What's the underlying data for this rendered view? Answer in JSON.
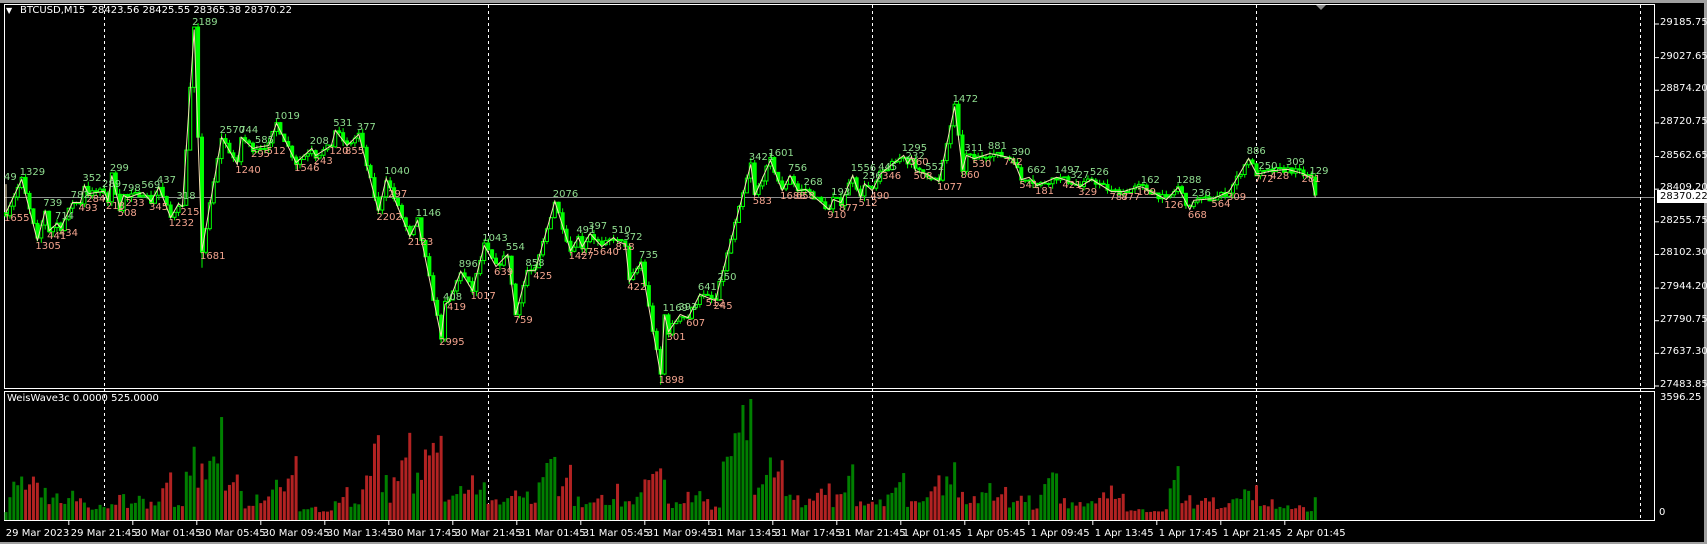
{
  "header": {
    "symbol_timeframe": "BTCUSD,M15",
    "ohlc": "28423.56 28425.55 28365.38 28370.22"
  },
  "indicator": {
    "label": "WeisWave3c 0.0000 525.0000",
    "max": "3596.25",
    "min": "0"
  },
  "current_price": "28370.22",
  "price_axis": [
    "29185.75",
    "29027.65",
    "28874.20",
    "28720.75",
    "28562.65",
    "28409.20",
    "28255.75",
    "28102.30",
    "27944.20",
    "27790.75",
    "27637.30",
    "27483.85"
  ],
  "time_axis": [
    "29 Mar 2023",
    "29 Mar 21:45",
    "30 Mar 01:45",
    "30 Mar 05:45",
    "30 Mar 09:45",
    "30 Mar 13:45",
    "30 Mar 17:45",
    "30 Mar 21:45",
    "31 Mar 01:45",
    "31 Mar 05:45",
    "31 Mar 09:45",
    "31 Mar 13:45",
    "31 Mar 17:45",
    "31 Mar 21:45",
    "1 Apr 01:45",
    "1 Apr 05:45",
    "1 Apr 09:45",
    "1 Apr 13:45",
    "1 Apr 17:45",
    "1 Apr 21:45",
    "2 Apr 01:45"
  ],
  "colors": {
    "candle": "#00ff00",
    "zigzag": "#f5deb3",
    "up_volume": "#008000",
    "down_volume": "#b22222",
    "high_label": "#8fdc8f",
    "low_label": "#f4a48e",
    "price_line": "#8c8c8c"
  },
  "wave_labels": [
    [
      0,
      28463,
      "49",
      "h"
    ],
    [
      0,
      28269,
      "1655",
      "l"
    ],
    [
      4,
      28485,
      "1329",
      "h"
    ],
    [
      8,
      28137,
      "1305",
      "l"
    ],
    [
      10,
      28339,
      "739",
      "h"
    ],
    [
      11,
      28184,
      "441",
      "l"
    ],
    [
      13,
      28278,
      "714",
      "h"
    ],
    [
      14,
      28198,
      "434",
      "l"
    ],
    [
      17,
      28377,
      "782",
      "h"
    ],
    [
      19,
      28316,
      "493",
      "l"
    ],
    [
      20,
      28457,
      "352",
      "h"
    ],
    [
      21,
      28358,
      "284",
      "l"
    ],
    [
      25,
      28429,
      "289",
      "h"
    ],
    [
      26,
      28325,
      "218",
      "l"
    ],
    [
      27,
      28504,
      "299",
      "h"
    ],
    [
      29,
      28292,
      "508",
      "l"
    ],
    [
      30,
      28410,
      "798",
      "h"
    ],
    [
      31,
      28339,
      "233",
      "l"
    ],
    [
      35,
      28424,
      "569",
      "h"
    ],
    [
      37,
      28321,
      "345",
      "l"
    ],
    [
      39,
      28448,
      "437",
      "h"
    ],
    [
      42,
      28245,
      "1232",
      "l"
    ],
    [
      44,
      28372,
      "318",
      "h"
    ],
    [
      45,
      28297,
      "215",
      "l"
    ],
    [
      48,
      29190,
      "2189",
      "h"
    ],
    [
      50,
      28090,
      "1681",
      "l"
    ],
    [
      55,
      28683,
      "2570",
      "h"
    ],
    [
      59,
      28495,
      "1240",
      "l"
    ],
    [
      60,
      28683,
      "744",
      "h"
    ],
    [
      63,
      28570,
      "295",
      "l"
    ],
    [
      64,
      28636,
      "585",
      "h"
    ],
    [
      67,
      28584,
      "512",
      "l"
    ],
    [
      69,
      28749,
      "1019",
      "h"
    ],
    [
      74,
      28504,
      "1546",
      "l"
    ],
    [
      78,
      28631,
      "208",
      "h"
    ],
    [
      79,
      28537,
      "243",
      "l"
    ],
    [
      83,
      28584,
      "120",
      "l"
    ],
    [
      84,
      28716,
      "531",
      "h"
    ],
    [
      87,
      28584,
      "855",
      "l"
    ],
    [
      90,
      28697,
      "377",
      "h"
    ],
    [
      95,
      28274,
      "2202",
      "l"
    ],
    [
      97,
      28490,
      "1040",
      "h"
    ],
    [
      98,
      28382,
      "297",
      "l"
    ],
    [
      103,
      28156,
      "2123",
      "l"
    ],
    [
      105,
      28292,
      "1146",
      "h"
    ],
    [
      111,
      27686,
      "2995",
      "l"
    ],
    [
      112,
      27898,
      "408",
      "h"
    ],
    [
      113,
      27850,
      "419",
      "l"
    ],
    [
      116,
      28053,
      "896",
      "h"
    ],
    [
      119,
      27902,
      "1017",
      "l"
    ],
    [
      122,
      28175,
      "1043",
      "h"
    ],
    [
      125,
      28015,
      "639",
      "l"
    ],
    [
      128,
      28133,
      "554",
      "h"
    ],
    [
      130,
      27789,
      "759",
      "l"
    ],
    [
      133,
      28057,
      "858",
      "h"
    ],
    [
      135,
      27996,
      "425",
      "l"
    ],
    [
      140,
      28382,
      "2076",
      "h"
    ],
    [
      144,
      28090,
      "1427",
      "l"
    ],
    [
      146,
      28212,
      "491",
      "h"
    ],
    [
      147,
      28109,
      "275",
      "l"
    ],
    [
      149,
      28231,
      "397",
      "h"
    ],
    [
      152,
      28109,
      "640",
      "l"
    ],
    [
      155,
      28212,
      "510",
      "h"
    ],
    [
      156,
      28133,
      "818",
      "l"
    ],
    [
      158,
      28180,
      "372",
      "h"
    ],
    [
      159,
      27945,
      "422",
      "l"
    ],
    [
      162,
      28095,
      "735",
      "h"
    ],
    [
      167,
      27507,
      "1898",
      "l"
    ],
    [
      168,
      27846,
      "1169",
      "h"
    ],
    [
      169,
      27709,
      "301",
      "l"
    ],
    [
      172,
      27850,
      "393",
      "h"
    ],
    [
      174,
      27775,
      "607",
      "l"
    ],
    [
      177,
      27945,
      "641",
      "h"
    ],
    [
      179,
      27869,
      "512",
      "l"
    ],
    [
      181,
      27855,
      "245",
      "l"
    ],
    [
      182,
      27991,
      "250",
      "h"
    ],
    [
      190,
      28556,
      "3421",
      "h"
    ],
    [
      191,
      28349,
      "583",
      "l"
    ],
    [
      195,
      28575,
      "1601",
      "h"
    ],
    [
      198,
      28372,
      "1688",
      "l"
    ],
    [
      200,
      28504,
      "756",
      "h"
    ],
    [
      202,
      28372,
      "658",
      "l"
    ],
    [
      204,
      28438,
      "268",
      "h"
    ],
    [
      210,
      28283,
      "910",
      "l"
    ],
    [
      211,
      28391,
      "193",
      "h"
    ],
    [
      213,
      28316,
      "877",
      "l"
    ],
    [
      216,
      28504,
      "1556",
      "h"
    ],
    [
      218,
      28339,
      "512",
      "l"
    ],
    [
      219,
      28466,
      "236",
      "h"
    ],
    [
      221,
      28372,
      "490",
      "l"
    ],
    [
      223,
      28509,
      "445",
      "h"
    ],
    [
      224,
      28466,
      "346",
      "l"
    ],
    [
      229,
      28598,
      "1295",
      "h"
    ],
    [
      230,
      28560,
      "232",
      "h"
    ],
    [
      231,
      28532,
      "360",
      "l"
    ],
    [
      232,
      28466,
      "508",
      "l"
    ],
    [
      235,
      28509,
      "552",
      "h"
    ],
    [
      238,
      28415,
      "1077",
      "l"
    ],
    [
      242,
      28828,
      "1472",
      "h"
    ],
    [
      244,
      28471,
      "860",
      "l"
    ],
    [
      245,
      28598,
      "311",
      "h"
    ],
    [
      247,
      28523,
      "530",
      "l"
    ],
    [
      251,
      28607,
      "881",
      "h"
    ],
    [
      255,
      28532,
      "742",
      "l"
    ],
    [
      257,
      28579,
      "390",
      "h"
    ],
    [
      259,
      28424,
      "541",
      "l"
    ],
    [
      261,
      28495,
      "662",
      "h"
    ],
    [
      263,
      28396,
      "181",
      "l"
    ],
    [
      268,
      28495,
      "1497",
      "h"
    ],
    [
      270,
      28424,
      "421",
      "l"
    ],
    [
      272,
      28471,
      "327",
      "h"
    ],
    [
      274,
      28391,
      "329",
      "l"
    ],
    [
      277,
      28485,
      "526",
      "h"
    ],
    [
      282,
      28368,
      "787",
      "l"
    ],
    [
      285,
      28368,
      "877",
      "l"
    ],
    [
      289,
      28391,
      "169",
      "l"
    ],
    [
      290,
      28448,
      "162",
      "h"
    ],
    [
      296,
      28330,
      "126",
      "l"
    ],
    [
      299,
      28448,
      "1288",
      "h"
    ],
    [
      302,
      28283,
      "668",
      "l"
    ],
    [
      303,
      28387,
      "236",
      "h"
    ],
    [
      308,
      28335,
      "564",
      "l"
    ],
    [
      312,
      28368,
      "309",
      "l"
    ],
    [
      317,
      28584,
      "886",
      "h"
    ],
    [
      319,
      28452,
      "772",
      "l"
    ],
    [
      320,
      28513,
      "250",
      "h"
    ],
    [
      323,
      28466,
      "428",
      "l"
    ],
    [
      327,
      28532,
      "309",
      "h"
    ],
    [
      331,
      28452,
      "281",
      "l"
    ],
    [
      333,
      28490,
      "129",
      "h"
    ]
  ]
}
